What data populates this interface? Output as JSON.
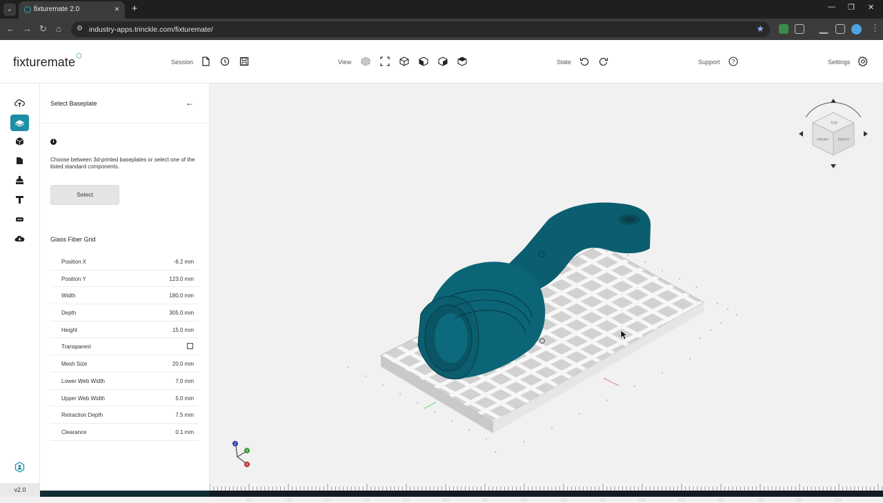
{
  "browser": {
    "tab_title": "fixturemate 2.0",
    "url": "industry-apps.trinckle.com/fixturemate/"
  },
  "header": {
    "logo": "fixturemate",
    "session_label": "Session",
    "view_label": "View",
    "state_label": "State",
    "support_label": "Support",
    "settings_label": "Settings"
  },
  "panel": {
    "title": "Select Baseplate",
    "info_text": "Choose between 3d-printed baseplates or select one of the listed standard components.",
    "select_button": "Select",
    "section_title": "Glass Fiber Grid",
    "properties": [
      {
        "label": "Position X",
        "value": "-6.2 mm"
      },
      {
        "label": "Position Y",
        "value": "123.0 mm"
      },
      {
        "label": "Width",
        "value": "180.0 mm"
      },
      {
        "label": "Depth",
        "value": "305.0 mm"
      },
      {
        "label": "Height",
        "value": "15.0 mm"
      },
      {
        "label": "Transparent",
        "value": ""
      },
      {
        "label": "Mesh Size",
        "value": "20.0 mm"
      },
      {
        "label": "Lower Web Width",
        "value": "7.0 mm"
      },
      {
        "label": "Upper Web Width",
        "value": "5.0 mm"
      },
      {
        "label": "Retraction Depth",
        "value": "7.5 mm"
      },
      {
        "label": "Clearance",
        "value": "0.1 mm"
      }
    ]
  },
  "navcube": {
    "top": "TOP",
    "front": "FRONT",
    "right": "RIGHT"
  },
  "axes": {
    "z": "Z",
    "y": "Y",
    "x": "X"
  },
  "ruler": [
    "50",
    "100",
    "150",
    "200",
    "250",
    "300",
    "350",
    "400",
    "450",
    "500",
    "550",
    "600",
    "650",
    "700",
    "750",
    "800"
  ],
  "version": "v2.0",
  "colors": {
    "accent": "#1d8ea5",
    "part": "#0b5e6f",
    "grid": "#e2e2e2"
  }
}
